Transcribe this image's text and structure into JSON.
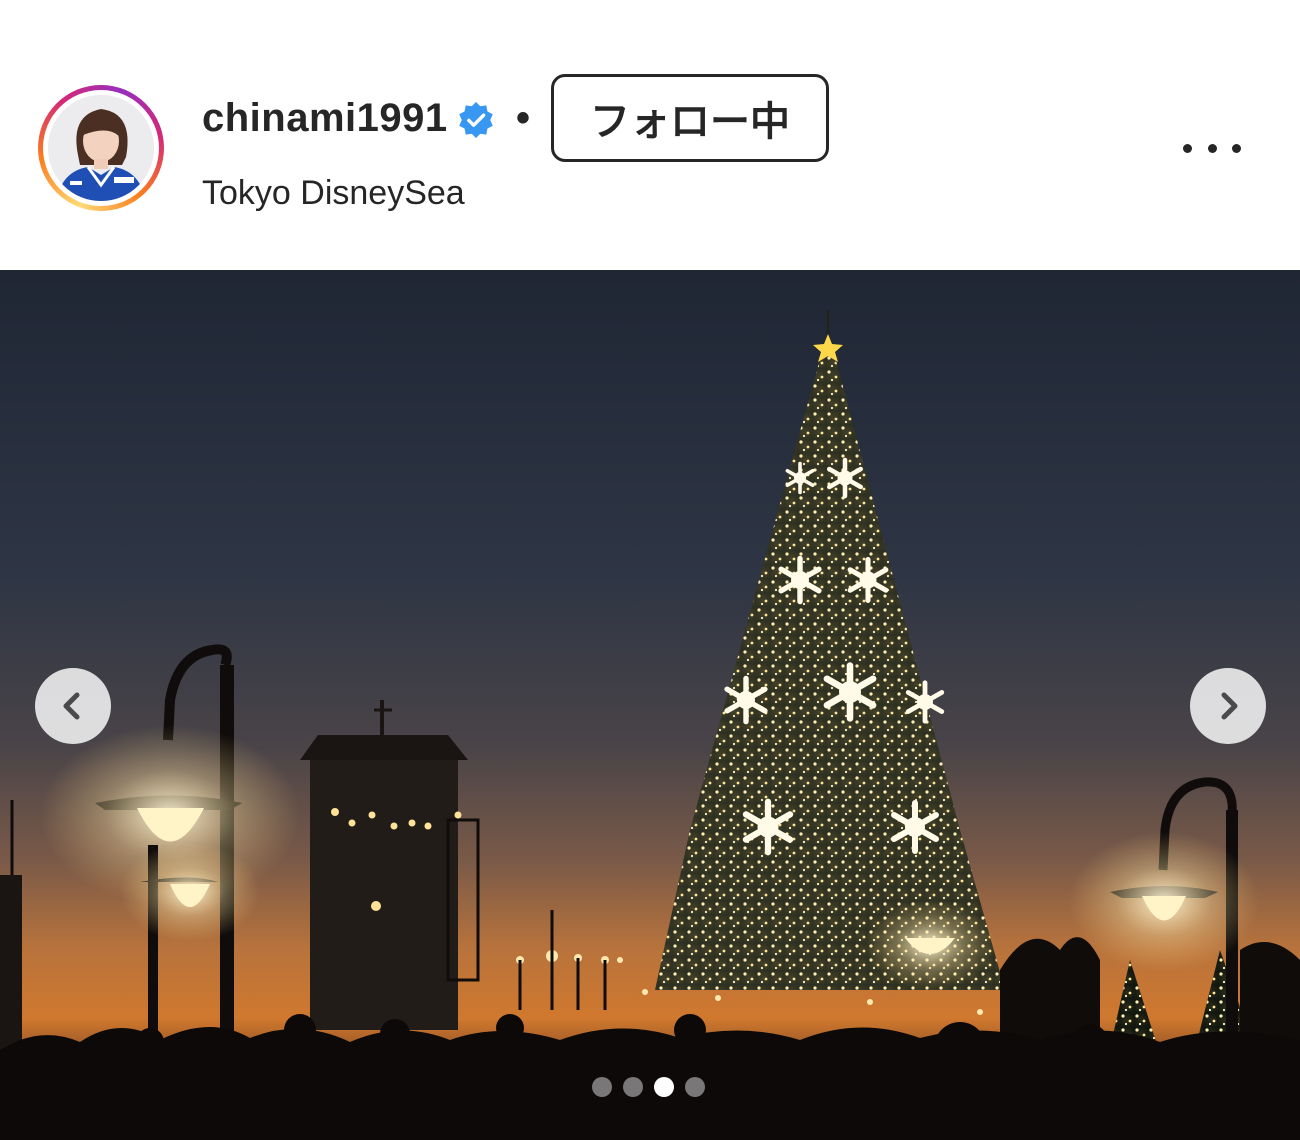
{
  "post": {
    "username": "chinami1991",
    "verified": true,
    "separator": "•",
    "follow_label": "フォロー中",
    "location": "Tokyo DisneySea"
  },
  "icons": {
    "verified": "verified-badge-icon",
    "more": "more-options-icon",
    "prev": "chevron-left-icon",
    "next": "chevron-right-icon"
  },
  "carousel": {
    "slide_count": 4,
    "active_index": 2
  },
  "colors": {
    "text": "#262626",
    "verified_blue": "#3897f0",
    "story_ring": [
      "#feda75",
      "#fa7e1e",
      "#d62976",
      "#962fbf"
    ]
  }
}
